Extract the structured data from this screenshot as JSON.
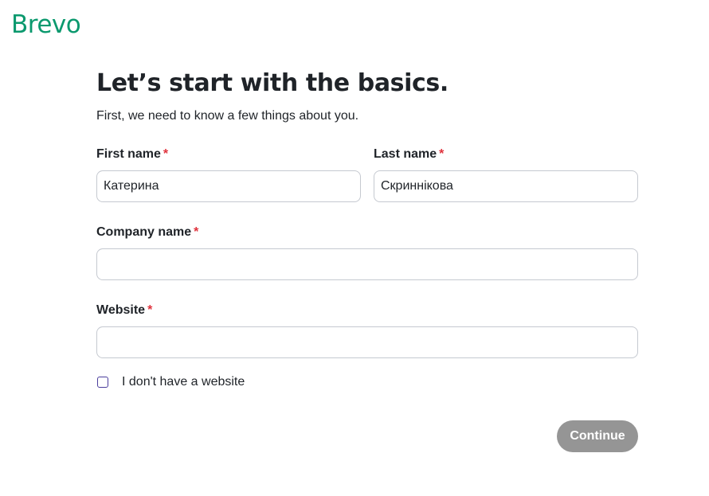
{
  "brand": {
    "logo_text": "Brevo",
    "color": "#0b996e"
  },
  "heading": {
    "title": "Let’s start with the basics.",
    "subtitle": "First, we need to know a few things about you."
  },
  "form": {
    "first_name": {
      "label": "First name",
      "required_mark": "*",
      "value": "Катерина"
    },
    "last_name": {
      "label": "Last name",
      "required_mark": "*",
      "value": "Скриннікова"
    },
    "company_name": {
      "label": "Company name",
      "required_mark": "*",
      "value": ""
    },
    "website": {
      "label": "Website",
      "required_mark": "*",
      "value": ""
    },
    "no_website": {
      "label": "I don't have a website",
      "checked": false
    }
  },
  "actions": {
    "continue_label": "Continue",
    "continue_color": "#959595"
  },
  "colors": {
    "required": "#e0323c",
    "checkbox_border": "#4a3d9c"
  }
}
